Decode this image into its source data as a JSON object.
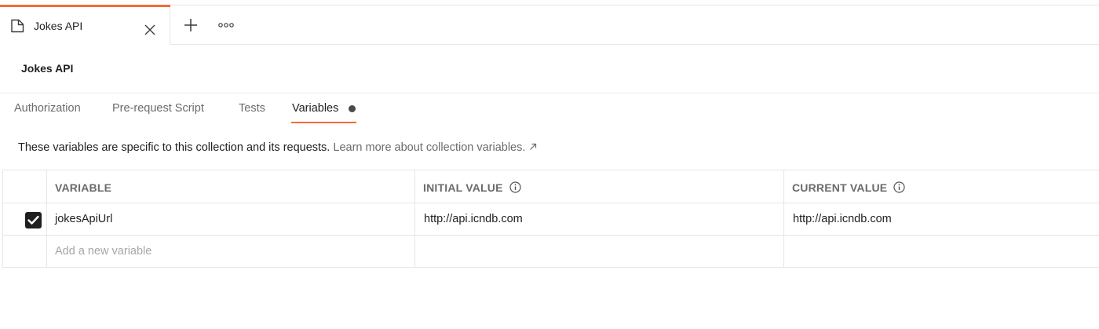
{
  "tab": {
    "label": "Jokes API",
    "icon": "collection-icon",
    "accent_color": "#f26b3a"
  },
  "header": {
    "title": "Jokes API"
  },
  "subtabs": [
    {
      "label": "Authorization"
    },
    {
      "label": "Pre-request Script"
    },
    {
      "label": "Tests"
    },
    {
      "label": "Variables",
      "active": true
    }
  ],
  "info": {
    "text": "These variables are specific to this collection and its requests.",
    "link": "Learn more about collection variables."
  },
  "table": {
    "headers": [
      "VARIABLE",
      "INITIAL VALUE",
      "CURRENT VALUE"
    ],
    "rows": [
      {
        "enabled": true,
        "variable": "jokesApiUrl",
        "initial": "http://api.icndb.com",
        "current": "http://api.icndb.com"
      }
    ],
    "new_row_placeholder": "Add a new variable"
  }
}
